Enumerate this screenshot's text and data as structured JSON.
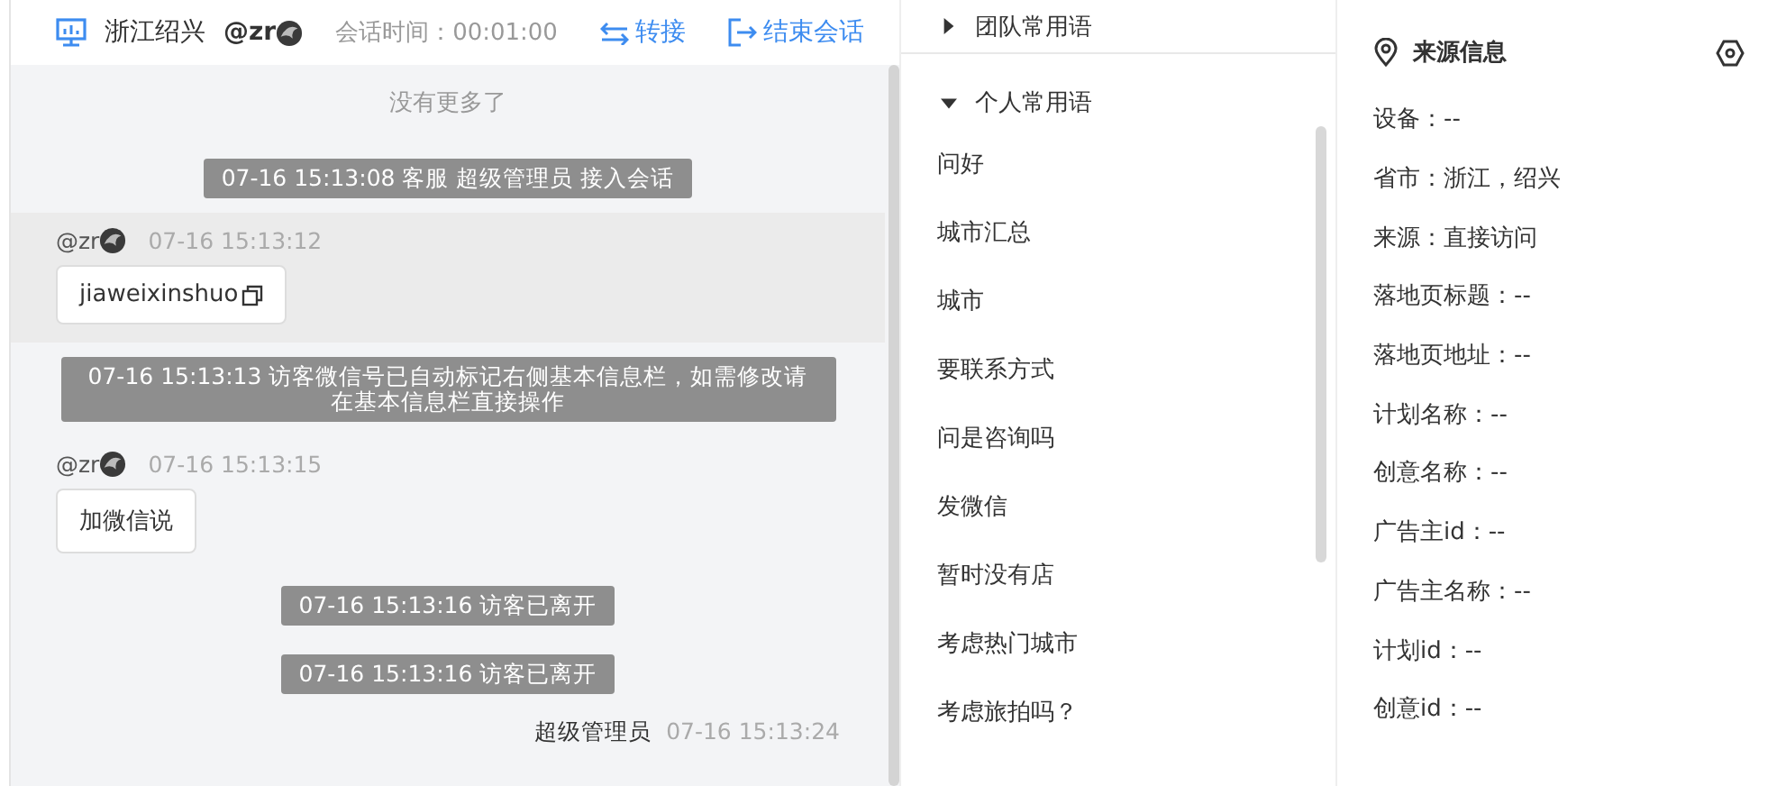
{
  "header": {
    "location": "浙江绍兴",
    "visitor": "@zr",
    "duration": "会话时间：00:01:00",
    "actions": [
      {
        "kind": "transfer",
        "label": "转接"
      },
      {
        "kind": "end",
        "label": "结束会话"
      }
    ]
  },
  "messages": [
    {
      "kind": "notice",
      "text": "没有更多了"
    },
    {
      "kind": "system",
      "text": "07-16 15:13:08 客服 超级管理员 接入会话"
    },
    {
      "kind": "visitor",
      "sender": "@zr",
      "time": "07-16 15:13:12",
      "text": "jiaweixinshuo",
      "copyable": true,
      "selected": true
    },
    {
      "kind": "system",
      "text": "07-16 15:13:13 访客微信号已自动标记右侧基本信息栏，如需修改请在基本信息栏直接操作"
    },
    {
      "kind": "visitor",
      "sender": "@zr",
      "time": "07-16 15:13:15",
      "text": "加微信说",
      "copyable": false,
      "selected": false
    },
    {
      "kind": "system",
      "text": "07-16 15:13:16 访客已离开"
    },
    {
      "kind": "system",
      "text": "07-16 15:13:16 访客已离开"
    },
    {
      "kind": "agent",
      "sender": "超级管理员",
      "time": "07-16 15:13:24"
    }
  ],
  "phrases": [
    {
      "title": "团队常用语",
      "expanded": false
    },
    {
      "title": "个人常用语",
      "expanded": true,
      "items": [
        "问好",
        "城市汇总",
        "城市",
        "要联系方式",
        "问是咨询吗",
        "发微信",
        "暂时没有店",
        "考虑热门城市",
        "考虑旅拍吗？"
      ]
    }
  ],
  "source_info": {
    "title": "来源信息",
    "fields": [
      "设备：--",
      "省市：浙江，绍兴",
      "来源：直接访问",
      "落地页标题：--",
      "落地页地址：--",
      "计划名称：--",
      "创意名称：--",
      "广告主id：--",
      "广告主名称：--",
      "计划id：--",
      "创意id：--"
    ]
  }
}
